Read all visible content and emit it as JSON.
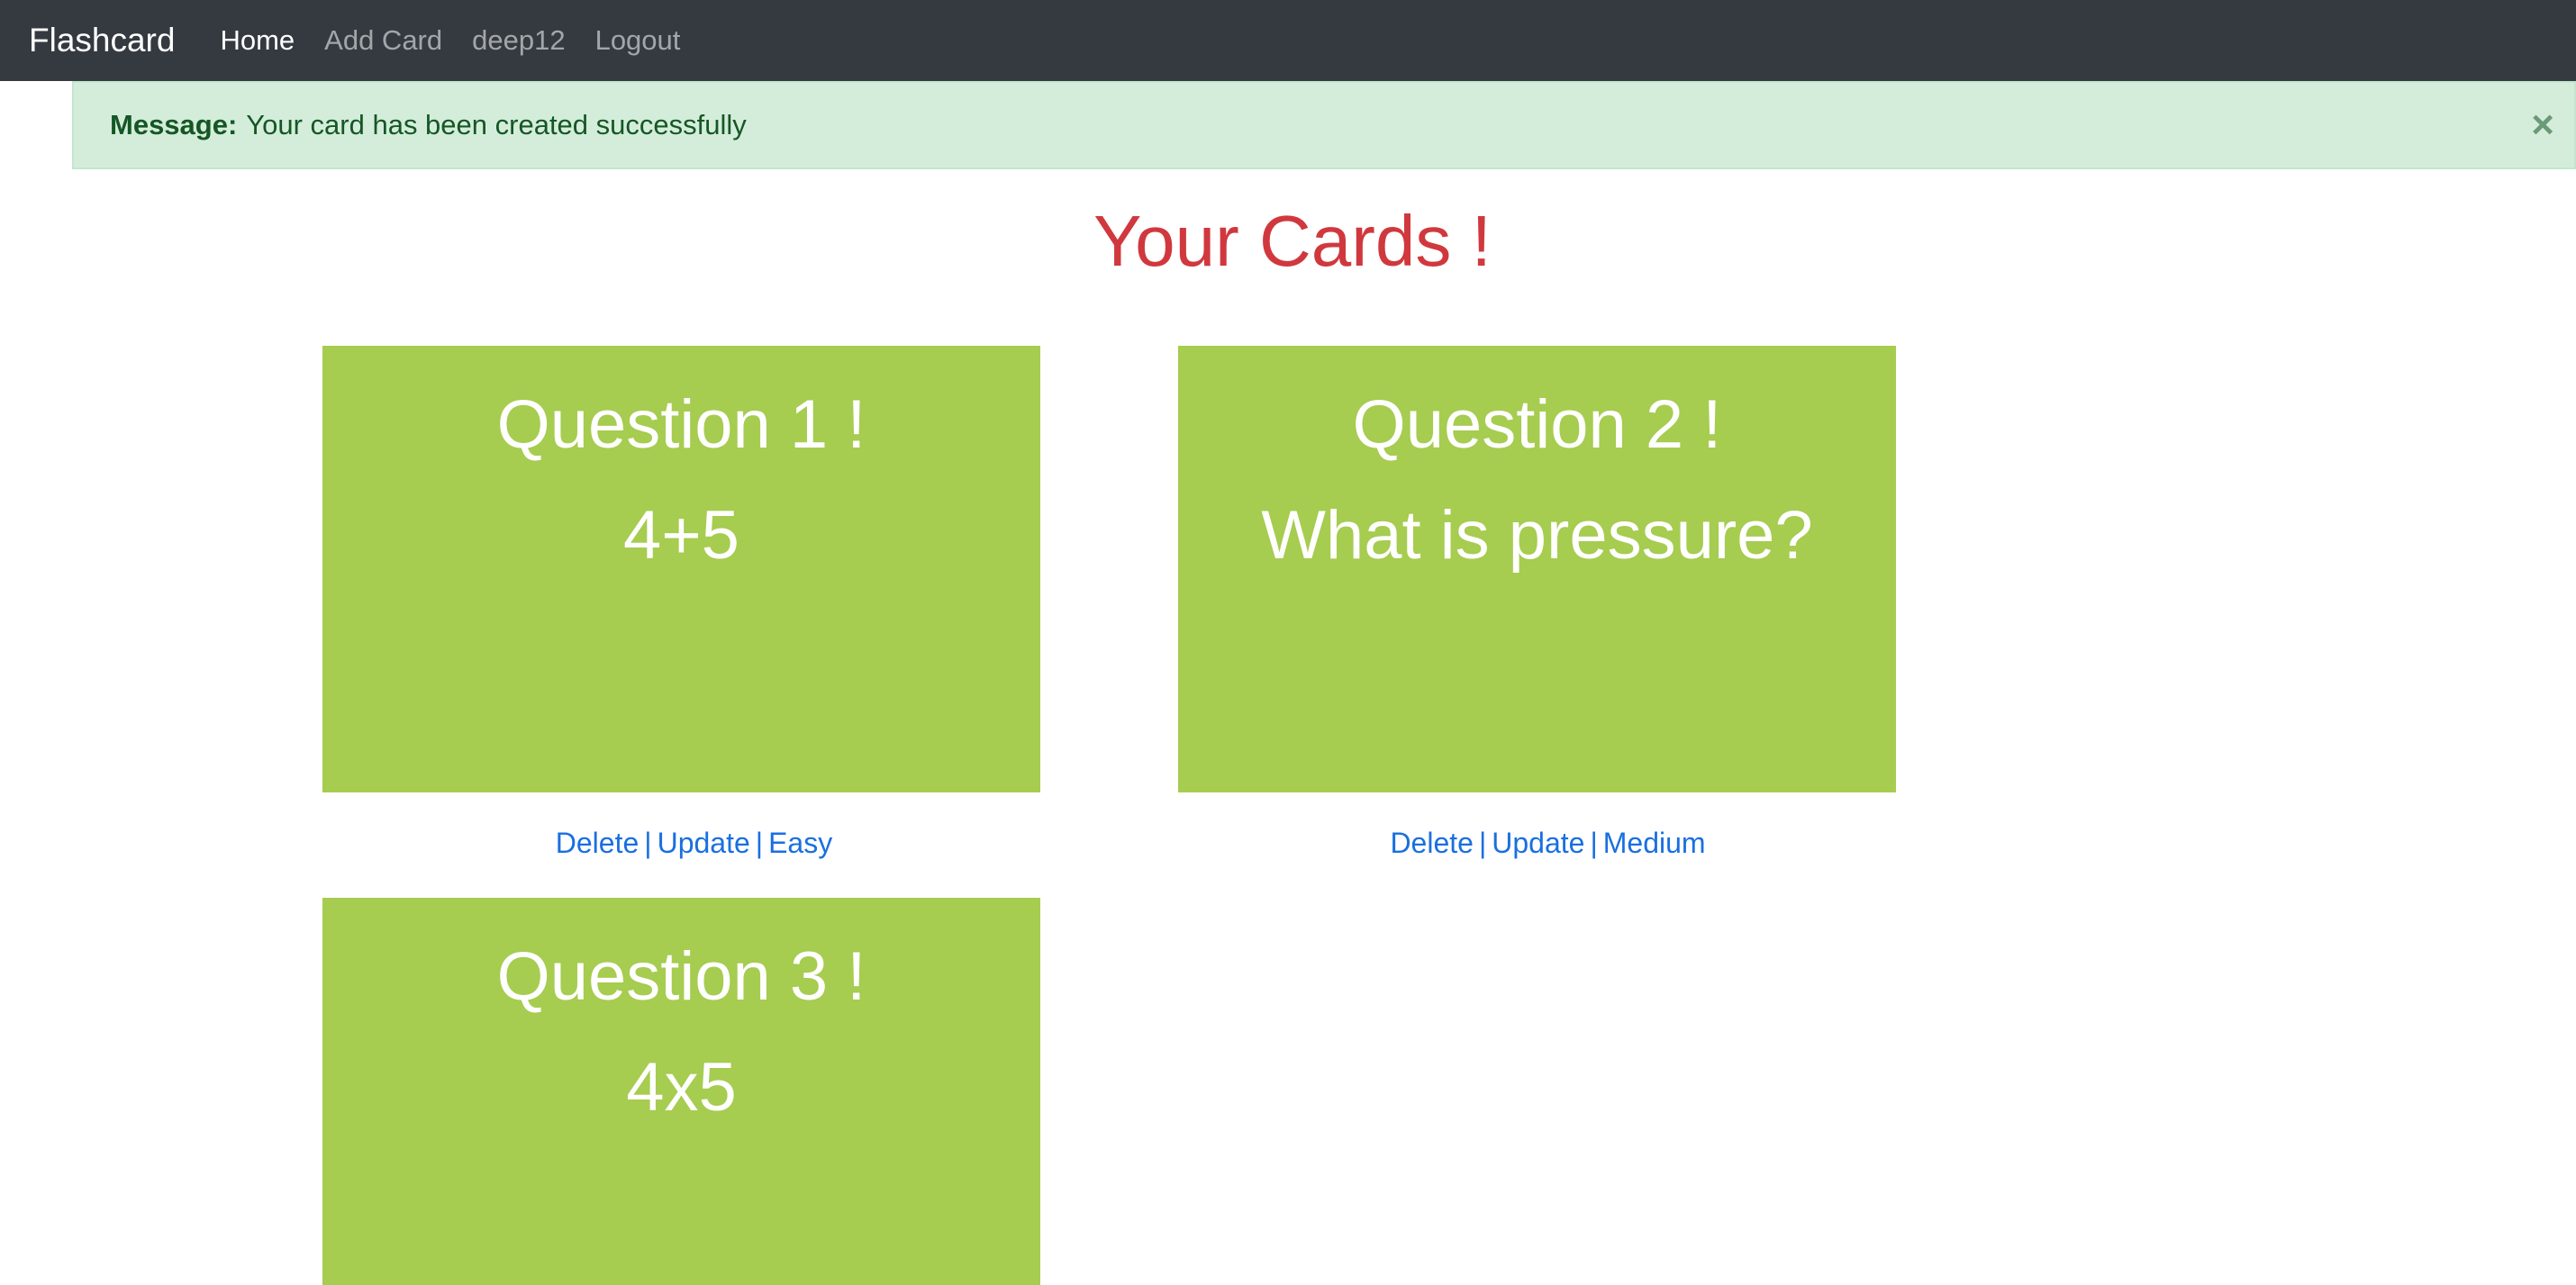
{
  "navbar": {
    "brand": "Flashcard",
    "links": [
      "Home",
      "Add Card",
      "deep12",
      "Logout"
    ],
    "active": "Home"
  },
  "alert": {
    "label": "Message:",
    "text": "Your card has been created successfully",
    "close": "×"
  },
  "heading": "Your Cards !",
  "cards": [
    {
      "title": "Question 1 !",
      "question": "4+5",
      "actions": [
        "Delete",
        "Update",
        "Easy"
      ]
    },
    {
      "title": "Question 2 !",
      "question": "What is pressure?",
      "actions": [
        "Delete",
        "Update",
        "Medium"
      ]
    },
    {
      "title": "Question 3 !",
      "question": "4x5",
      "actions": []
    }
  ],
  "separator": "|",
  "colors": {
    "navbar": "#343a40",
    "alert_bg": "#d4eddb",
    "heading": "#d0383e",
    "card": "#a6cc50",
    "link": "#1a6fe0"
  }
}
